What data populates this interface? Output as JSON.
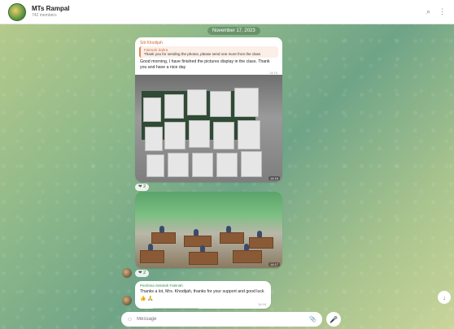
{
  "header": {
    "title": "MTs Rampal",
    "subtitle": "742 members",
    "actions": [
      {
        "name": "search-icon",
        "glyph": "⌕"
      },
      {
        "name": "more-icon",
        "glyph": "⋮"
      }
    ]
  },
  "date_separator": "November 17, 2023",
  "message1": {
    "sender": "Siti Khodijah",
    "reply_name": "Fatimah Zahra",
    "reply_text": "Thank you for sending the photos, please send one more from the class",
    "text": "Good morning, I have finished the pictures display in the class. Thank you and have a nice day",
    "time": "14:15",
    "photo_time": "14:16",
    "reaction": "❤ 2"
  },
  "message2": {
    "photo_time": "14:17",
    "reaction": "❤ 2"
  },
  "message3": {
    "sender": "Pembina Sekolah Fatimah",
    "text": "Thanks a lot, Mrs. Khodijah, thanks for your support and good luck 🙏👍",
    "emojis": "👍 🙏",
    "time": "14:18"
  },
  "composer": {
    "placeholder": "Message",
    "emoji_icon": "☺",
    "attach_icon": "📎",
    "mic_icon": "🎤"
  },
  "scroll_icon": "↓",
  "colors": {
    "accent": "#3f8f4a",
    "sender_orange": "#d56a3a",
    "bg_green": "#8fb98a"
  }
}
